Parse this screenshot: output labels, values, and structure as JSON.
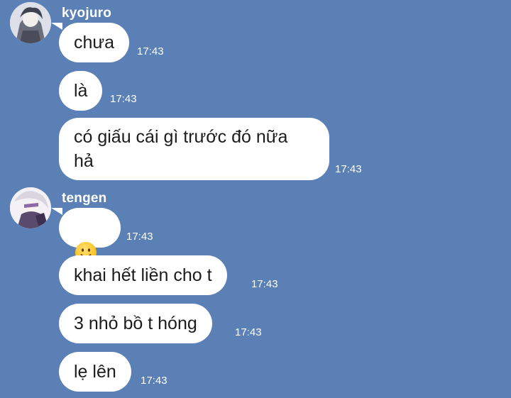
{
  "colors": {
    "background": "#5b80b5",
    "bubble": "#ffffff",
    "text": "#1c1c1c",
    "meta_text": "#ffffff"
  },
  "groups": [
    {
      "sender": "kyojuro",
      "avatar_icon": "avatar-kyojuro",
      "messages": [
        {
          "text": "chưa",
          "time": "17:43"
        },
        {
          "text": "là",
          "time": "17:43"
        },
        {
          "text": "có giấu cái gì trước đó nữa\nhả",
          "time": "17:43"
        }
      ]
    },
    {
      "sender": "tengen",
      "avatar_icon": "avatar-tengen",
      "messages": [
        {
          "emoji": "slightly-smiling-face-icon",
          "time": "17:43"
        },
        {
          "text": "khai hết liền cho t",
          "time": "17:43"
        },
        {
          "text": "3 nhỏ bồ t hóng",
          "time": "17:43"
        },
        {
          "text": "lẹ lên",
          "time": "17:43"
        }
      ]
    }
  ]
}
